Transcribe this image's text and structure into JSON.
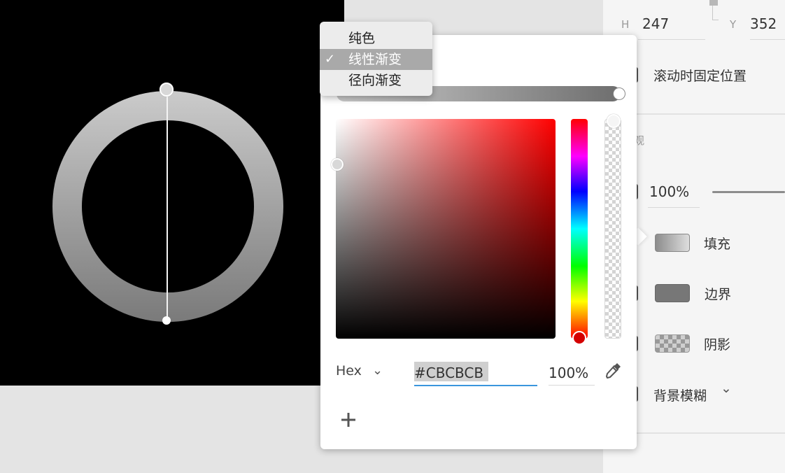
{
  "inspector": {
    "h_label": "H",
    "h_value": "247",
    "y_label": "Y",
    "y_value": "352",
    "fixed_position_label": "滚动时固定位置",
    "appearance_section_label": "观",
    "opacity_value": "100%",
    "fill_label": "填充",
    "border_label": "边界",
    "shadow_label": "阴影",
    "blur_label": "背景模糊",
    "blur_chevron": "⌄"
  },
  "menu": {
    "items": [
      {
        "label": "纯色",
        "selected": false
      },
      {
        "label": "线性渐变",
        "selected": true
      },
      {
        "label": "径向渐变",
        "selected": false
      }
    ],
    "check_glyph": "✓"
  },
  "color_picker": {
    "format_label": "Hex",
    "format_chevron": "⌄",
    "hex_value": "#CBCBCB",
    "opacity_value": "100%",
    "add_symbol": "+"
  },
  "colors": {
    "gradient_start": "#cbcbcb",
    "gradient_end": "#6e6e6e",
    "accent_underline": "#3a96dd",
    "hue": "#ff0000"
  },
  "icons": {
    "eyedropper": "eyedropper-icon",
    "add": "plus-icon",
    "chevron": "chevron-down-icon",
    "check": "checkmark-icon"
  }
}
